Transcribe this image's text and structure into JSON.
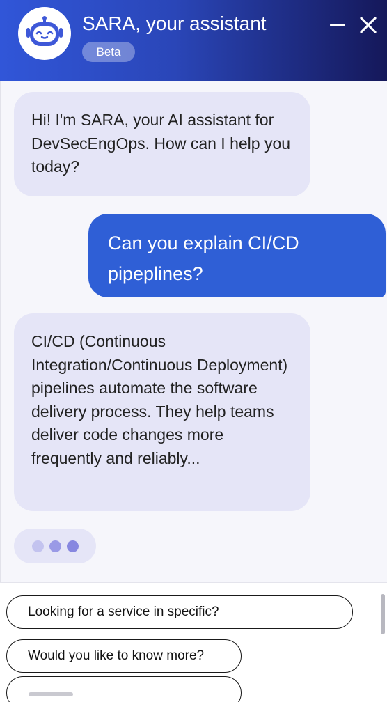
{
  "header": {
    "title": "SARA, your assistant",
    "badge": "Beta",
    "logo_icon": "robot-icon",
    "minimize_icon": "minimize-icon",
    "close_icon": "close-icon"
  },
  "messages": [
    {
      "role": "assistant",
      "text": "Hi! I'm SARA, your AI assistant for DevSecEngOps. How can I help you today?"
    },
    {
      "role": "user",
      "text": "Can you explain CI/CD pipeplines?"
    },
    {
      "role": "assistant",
      "text": "CI/CD (Continuous Integration/Continuous Deployment) pipelines automate the software delivery process. They help teams deliver code changes more frequently and reliably..."
    }
  ],
  "typing_indicator": {
    "dots": 3
  },
  "suggestions": [
    "Looking for a service in specific?",
    "Would you like to know more?",
    ""
  ],
  "colors": {
    "header_gradient_start": "#3156d8",
    "header_gradient_end": "#15185a",
    "bot_bubble": "#e5e5f7",
    "user_bubble": "#2f5fd6",
    "typing_dot_1": "#c3c3ef",
    "typing_dot_2": "#9a9ae6",
    "typing_dot_3": "#8787e0"
  }
}
